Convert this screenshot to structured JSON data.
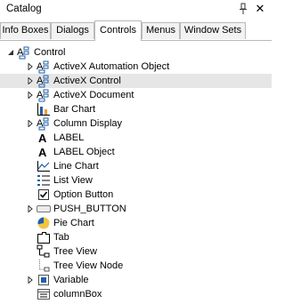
{
  "panel": {
    "title": "Catalog",
    "pin_icon": "pin-icon",
    "close_icon": "close-icon"
  },
  "tabs": [
    {
      "label": "Info Boxes",
      "active": false
    },
    {
      "label": "Dialogs",
      "active": false
    },
    {
      "label": "Controls",
      "active": true
    },
    {
      "label": "Menus",
      "active": false
    },
    {
      "label": "Window Sets",
      "active": false
    }
  ],
  "tree": {
    "root": {
      "label": "Control",
      "icon": "control-icon",
      "expanded": true
    },
    "items": [
      {
        "label": "ActiveX Automation Object",
        "icon": "control-icon",
        "expandable": true
      },
      {
        "label": "ActiveX Control",
        "icon": "control-icon",
        "expandable": true,
        "highlighted": true
      },
      {
        "label": "ActiveX Document",
        "icon": "control-icon",
        "expandable": true
      },
      {
        "label": "Bar Chart",
        "icon": "bar-chart-icon",
        "expandable": false
      },
      {
        "label": "Column Display",
        "icon": "control-icon",
        "expandable": true
      },
      {
        "label": "LABEL",
        "icon": "label-icon",
        "expandable": false
      },
      {
        "label": "LABEL Object",
        "icon": "label-icon",
        "expandable": false
      },
      {
        "label": "Line Chart",
        "icon": "line-chart-icon",
        "expandable": false
      },
      {
        "label": "List View",
        "icon": "list-view-icon",
        "expandable": false
      },
      {
        "label": "Option Button",
        "icon": "checkbox-icon",
        "expandable": false
      },
      {
        "label": "PUSH_BUTTON",
        "icon": "push-button-icon",
        "expandable": true
      },
      {
        "label": "Pie Chart",
        "icon": "pie-chart-icon",
        "expandable": false
      },
      {
        "label": "Tab",
        "icon": "tab-icon",
        "expandable": false
      },
      {
        "label": "Tree View",
        "icon": "tree-view-icon",
        "expandable": false
      },
      {
        "label": "Tree View Node",
        "icon": "tree-node-icon",
        "expandable": false
      },
      {
        "label": "Variable",
        "icon": "variable-icon",
        "expandable": true
      },
      {
        "label": "columnBox",
        "icon": "column-box-icon",
        "expandable": false
      }
    ]
  },
  "colors": {
    "highlight": "#e6e6e6",
    "tab_border": "#b9b9b9",
    "tab_inactive": "#f2f2f2",
    "icon_blue": "#1f5fa8",
    "pie_yellow": "#f3c443"
  }
}
